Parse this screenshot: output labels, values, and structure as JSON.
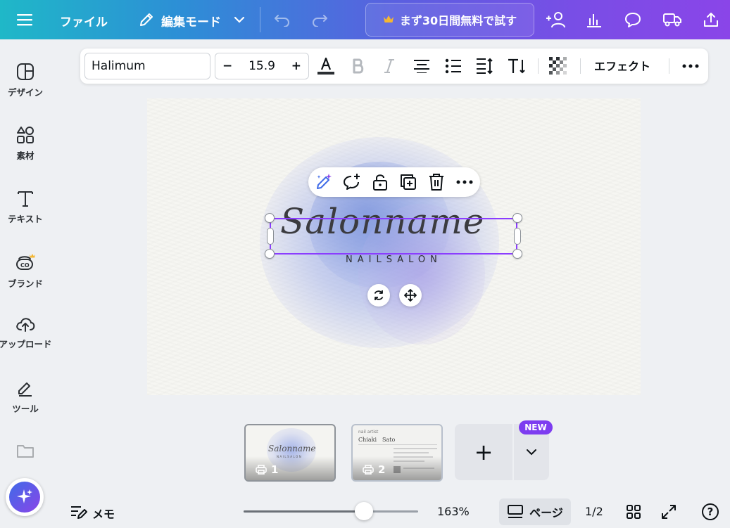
{
  "topbar": {
    "menu_icon": "hamburger-icon",
    "file_label": "ファイル",
    "edit_mode_label": "編集モード",
    "trial_label": "まず30日間無料で試す",
    "icons": [
      "undo-icon",
      "redo-icon",
      "crown-icon",
      "share-people-icon",
      "insights-chart-icon",
      "comment-icon",
      "truck-icon",
      "upload-export-icon"
    ]
  },
  "sidebar": {
    "items": [
      {
        "label": "デザイン",
        "icon": "design-panel-icon"
      },
      {
        "label": "素材",
        "icon": "elements-shapes-icon"
      },
      {
        "label": "テキスト",
        "icon": "text-t-icon"
      },
      {
        "label": "ブランド",
        "icon": "brand-co-icon"
      },
      {
        "label": "アップロード",
        "icon": "cloud-upload-icon"
      },
      {
        "label": "ツール",
        "icon": "pen-tool-icon"
      }
    ]
  },
  "text_toolbar": {
    "font_name": "Halimum",
    "font_size": "15.9",
    "minus": "−",
    "plus": "+",
    "effect_label": "エフェクト"
  },
  "canvas": {
    "title_text": "Salonname",
    "subtitle_text": "NAILSALON",
    "accent_color": "#8b3dff"
  },
  "pages": {
    "thumb1_num": "1",
    "thumb2_num": "2",
    "thumb1_title": "Salonname",
    "thumb1_sub": "NAILSALON",
    "thumb2_header": "nail artist",
    "thumb2_name": "Chiaki　Sato",
    "new_badge": "NEW",
    "add_label": "+"
  },
  "bottom": {
    "memo_label": "メモ",
    "zoom": "163%",
    "zoom_fraction": 0.69,
    "page_label": "ページ",
    "page_count": "1/2",
    "help": "?"
  }
}
